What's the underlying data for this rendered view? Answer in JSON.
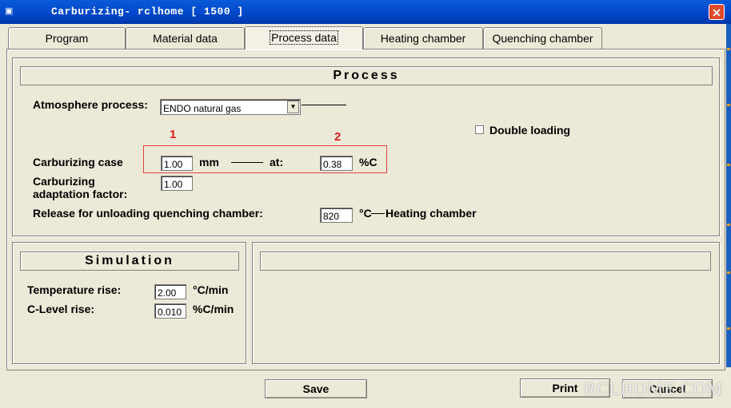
{
  "window": {
    "title": "Carburizing- rclhome  [ 1500 ]",
    "app_icon": "app-icon",
    "close_glyph": "✕"
  },
  "tabs": [
    {
      "label": "Program",
      "active": false
    },
    {
      "label": "Material data",
      "active": false
    },
    {
      "label": "Process data",
      "active": true
    },
    {
      "label": "Heating chamber",
      "active": false
    },
    {
      "label": "Quenching chamber",
      "active": false
    }
  ],
  "process": {
    "heading": "Process",
    "atmosphere_label": "Atmosphere process:",
    "atmosphere_value": "ENDO natural gas",
    "double_loading_label": "Double loading",
    "double_loading_checked": false,
    "marker_1": "1",
    "marker_2": "2",
    "case_label": "Carburizing case",
    "case_value": "1.00",
    "case_unit": "mm",
    "at_label": "at:",
    "at_value": "0.38",
    "at_unit": "%C",
    "adaptation_label_1": "Carburizing",
    "adaptation_label_2": "adaptation factor:",
    "adaptation_value": "1.00",
    "release_label": "Release for unloading quenching chamber:",
    "release_value": "820",
    "release_unit": "°C",
    "release_target": "Heating chamber"
  },
  "simulation": {
    "heading": "Simulation",
    "temp_label": "Temperature rise:",
    "temp_value": "2.00",
    "temp_unit": "°C/min",
    "clevel_label": "C-Level rise:",
    "clevel_value": "0.010",
    "clevel_unit": "%C/min"
  },
  "buttons": {
    "save": "Save",
    "print": "Print",
    "cancel": "Cancel"
  },
  "watermark": "RCLHOME.COM",
  "colors": {
    "titlebar": "#0046c8",
    "background": "#ece9d8",
    "annotation_red": "#e02020"
  }
}
